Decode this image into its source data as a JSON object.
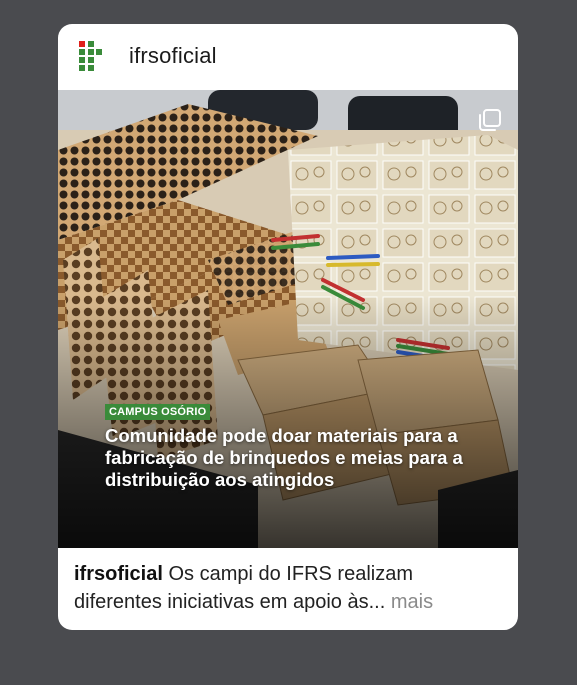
{
  "post": {
    "username": "ifrsoficial",
    "image": {
      "tag": "CAMPUS OSÓRIO",
      "headline": "Comunidade pode doar materiais para a fabricação de brinquedos e meias para a distribuição aos atingidos"
    },
    "caption": {
      "username": "ifrsoficial",
      "text": "Os campi do IFRS realizam diferentes iniciativas em apoio às",
      "ellipsis": "...",
      "more_label": "mais"
    }
  },
  "colors": {
    "background": "#4a4b4f",
    "logo_green": "#3a8b3a",
    "logo_red": "#e0201b",
    "tag_green": "#3a8b3a"
  },
  "icons": {
    "logo": "ifrs-logo",
    "multi": "carousel-multi-icon"
  }
}
